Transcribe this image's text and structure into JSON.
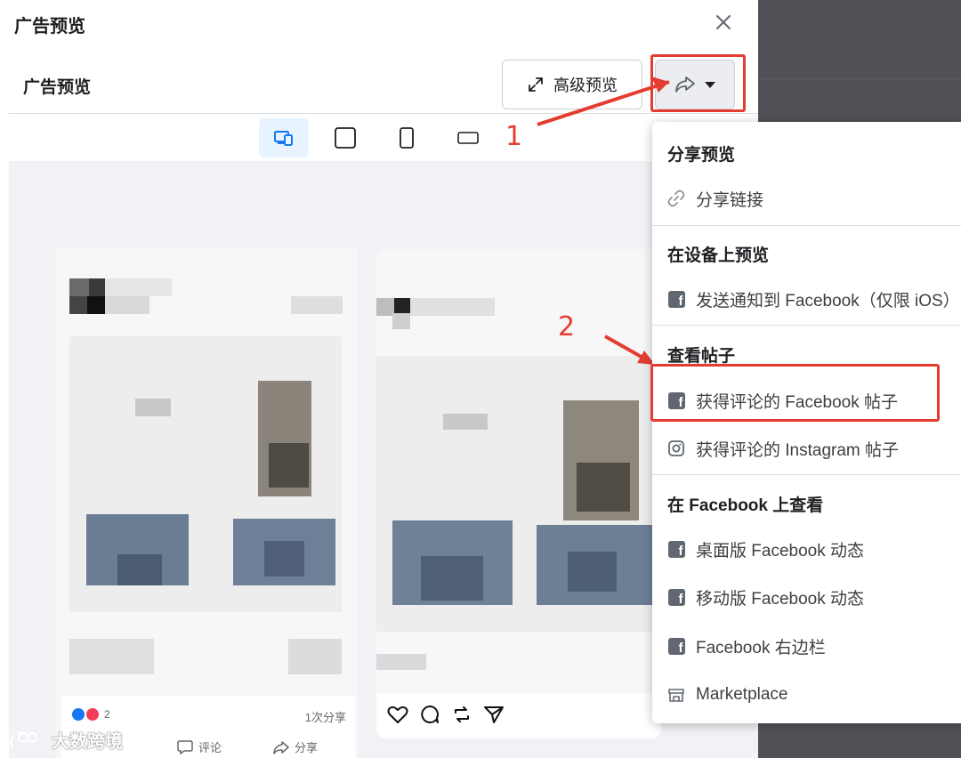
{
  "dialog": {
    "title": "广告预览",
    "section_title": "广告预览",
    "advanced_preview_label": "高级预览",
    "close_icon": "close-icon",
    "device_tabs": [
      {
        "name": "responsive",
        "icon": "responsive-devices-icon",
        "active": true
      },
      {
        "name": "desktop",
        "icon": "square-icon",
        "active": false
      },
      {
        "name": "mobile",
        "icon": "phone-icon",
        "active": false
      },
      {
        "name": "landscape",
        "icon": "landscape-icon",
        "active": false
      }
    ]
  },
  "fb_post": {
    "reaction_count": "2",
    "shares_text": "1次分享",
    "comment_label": "评论",
    "share_label": "分享"
  },
  "annotations": {
    "step1": "1",
    "step2": "2"
  },
  "share_menu": {
    "section1_header": "分享预览",
    "share_link": "分享链接",
    "section2_header": "在设备上预览",
    "send_notification": "发送通知到 Facebook（仅限 iOS）",
    "section3_header": "查看帖子",
    "fb_post_with_comments": "获得评论的 Facebook 帖子",
    "ig_post_with_comments": "获得评论的 Instagram 帖子",
    "section4_header": "在 Facebook 上查看",
    "desktop_feed": "桌面版 Facebook 动态",
    "mobile_feed": "移动版 Facebook 动态",
    "right_column": "Facebook 右边栏",
    "marketplace": "Marketplace"
  },
  "watermark": {
    "text": "大数跨境"
  },
  "colors": {
    "accent_red": "#e43d30",
    "active_tab_bg": "#e7f3ff",
    "facebook_blue": "#1877f2",
    "icon_gray": "#606770"
  }
}
